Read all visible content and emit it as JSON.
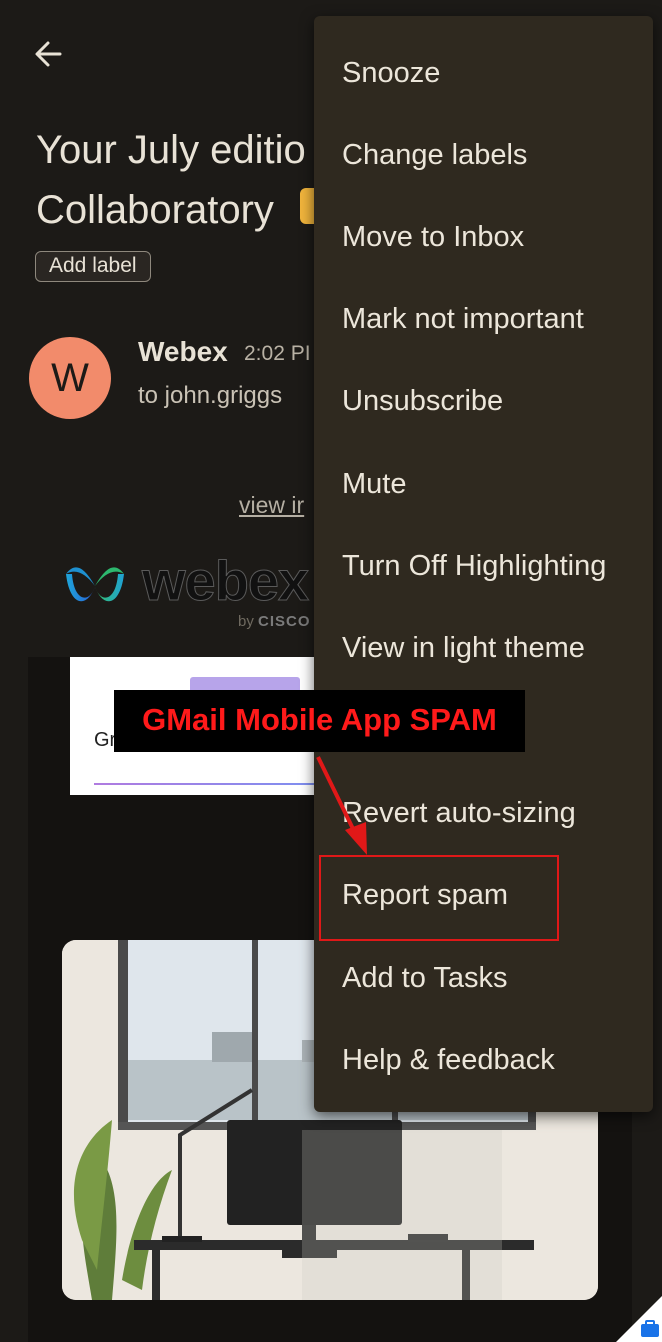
{
  "email": {
    "subject_line1": "Your July editio",
    "subject_line2": "Collaboratory",
    "add_label": "Add label",
    "avatar_letter": "W",
    "sender": "Webex",
    "time": "2:02 PI",
    "recipient": "to john.griggs",
    "view_link": "view ir",
    "logo_text": "webex",
    "logo_sub_prefix": "by ",
    "logo_sub_brand": "CISCO",
    "newsletter_text": "Gr"
  },
  "menu": {
    "items": [
      "Snooze",
      "Change labels",
      "Move to Inbox",
      "Mark not important",
      "Unsubscribe",
      "Mute",
      "Turn Off Highlighting",
      "View in light theme",
      "Revert auto-sizing",
      "Report spam",
      "Add to Tasks",
      "Help & feedback"
    ]
  },
  "annotation": {
    "callout": "GMail Mobile App SPAM"
  },
  "colors": {
    "background": "#1c1a17",
    "menu_background": "#2f291f",
    "avatar": "#f28b6b",
    "annotation_red": "#e01818"
  },
  "icons": [
    "arrow-left-icon",
    "webex-logo-icon",
    "briefcase-icon"
  ]
}
